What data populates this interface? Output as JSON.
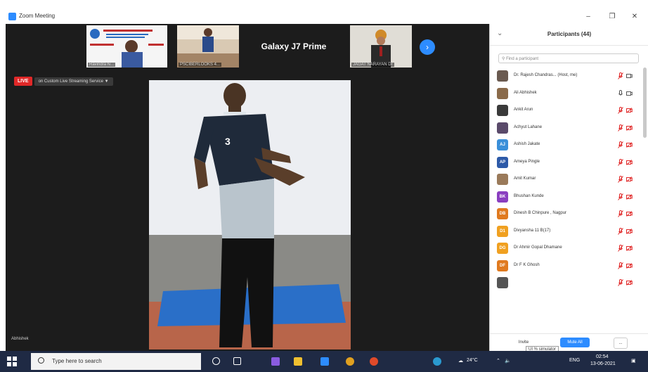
{
  "window": {
    "title": "Zoom Meeting",
    "minimize": "–",
    "maximize": "❐",
    "close": "✕"
  },
  "thumbnails": [
    {
      "name": "Ravindra N..."
    },
    {
      "name": "PSCIBERLOOKS 4..."
    },
    {
      "label": "Galaxy J7 Prime"
    },
    {
      "name": "JAGAT NARAYAN Dr"
    }
  ],
  "next_arrow": "›",
  "live": {
    "badge": "LIVE",
    "stream": "on Custom Live Streaming Service ▼"
  },
  "speaker": {
    "name": "Abhishek"
  },
  "participants": {
    "title": "Participants (44)",
    "search_placeholder": "Find a participant",
    "list": [
      {
        "name": "Dr. Rajesh Chandras... (Host, me)",
        "initials": "",
        "color": "#6a5a50",
        "mic": "muted"
      },
      {
        "name": "Ali Abhishek",
        "initials": "",
        "color": "#8a6a4a",
        "mic": "on"
      },
      {
        "name": "Ankit Arun",
        "initials": "",
        "color": "#3a3a3a",
        "mic": "muted"
      },
      {
        "name": "Achyut Lahane",
        "initials": "",
        "color": "#5a4a6a",
        "mic": "muted"
      },
      {
        "name": "Ashish Jakate",
        "initials": "AJ",
        "color": "#3a8fd9",
        "mic": "muted"
      },
      {
        "name": "Ameya Pingle",
        "initials": "AP",
        "color": "#2d5aa8",
        "mic": "muted"
      },
      {
        "name": "Amit Kumar",
        "initials": "",
        "color": "#9a7a5a",
        "mic": "muted"
      },
      {
        "name": "Bhushan Kunde",
        "initials": "BK",
        "color": "#8a3fc0",
        "mic": "muted"
      },
      {
        "name": "Dinesh B Chinpure , Nagpur",
        "initials": "DB",
        "color": "#e07a1f",
        "mic": "muted"
      },
      {
        "name": "Divyansha 11 B(17)",
        "initials": "D1",
        "color": "#f0a020",
        "mic": "muted"
      },
      {
        "name": "Dr Ahmir Gopal Dhamane",
        "initials": "DG",
        "color": "#f0a020",
        "mic": "muted"
      },
      {
        "name": "Dr F K Ghosh",
        "initials": "DF",
        "color": "#e07a1f",
        "mic": "muted"
      },
      {
        "name": "",
        "initials": "",
        "color": "#555",
        "mic": "muted"
      }
    ],
    "footer": {
      "invite": "Invite",
      "mute_all": "Mute All",
      "more": "..."
    }
  },
  "tooltip": "UI % simulator",
  "taskbar": {
    "search_placeholder": "Type here to search",
    "weather": "24°C",
    "lang": "ENG",
    "time": "02:54",
    "date": "13-06-2021"
  },
  "colors": {
    "zoom_blue": "#2d8cff",
    "muted_red": "#e02828",
    "live_red": "#e02828",
    "taskbar": "#1f2a44"
  }
}
